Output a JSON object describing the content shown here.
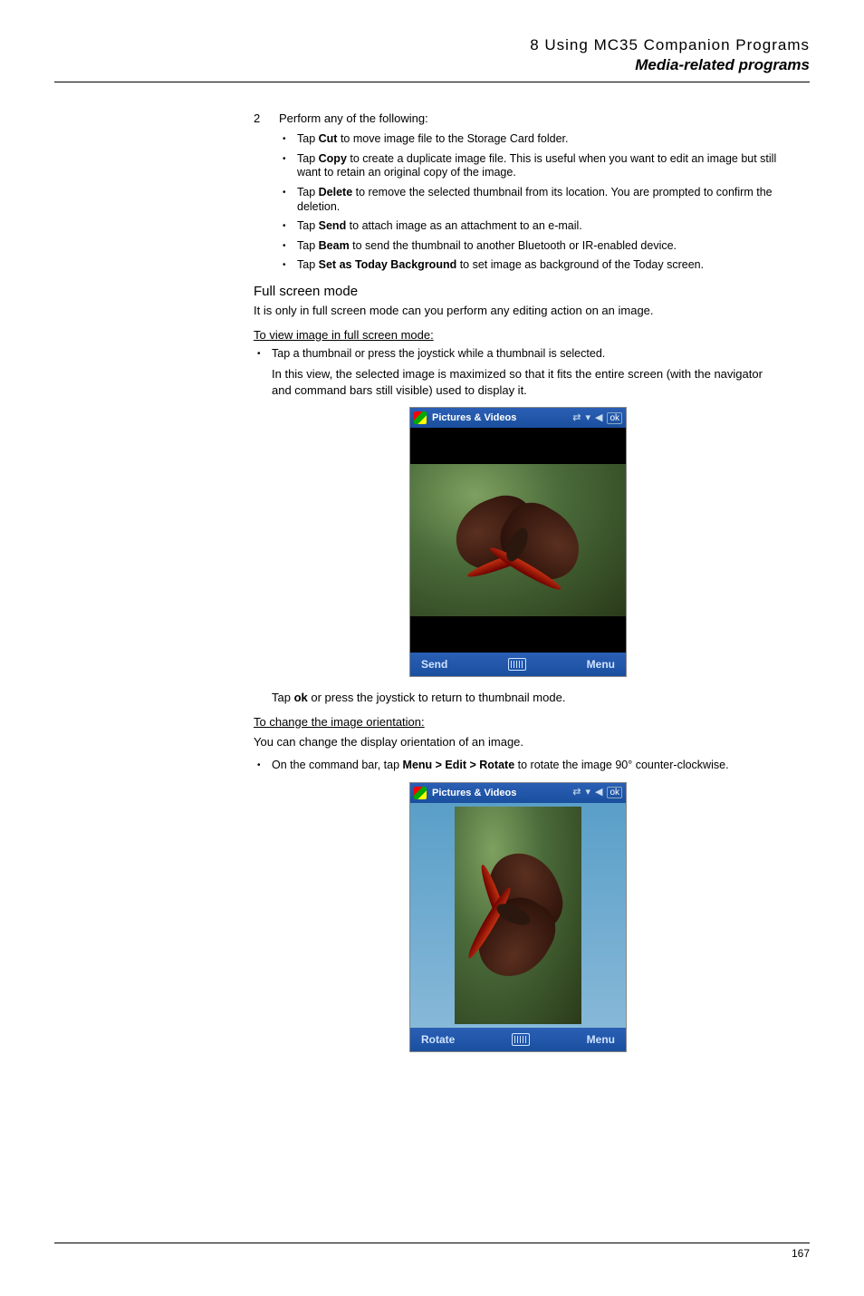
{
  "header": {
    "chapter": "8 Using MC35 Companion Programs",
    "section": "Media-related programs"
  },
  "step": {
    "num": "2",
    "intro": "Perform any of the following:"
  },
  "bullets": [
    {
      "action": "Cut",
      "before": "Tap ",
      "after": " to move image file to the Storage Card folder."
    },
    {
      "action": "Copy",
      "before": "Tap ",
      "after": " to create a duplicate image file. This is useful when you want to edit an image but still want to retain an original copy of the image."
    },
    {
      "action": "Delete",
      "before": "Tap ",
      "after": " to remove the selected thumbnail from its location. You are prompted to confirm the deletion."
    },
    {
      "action": "Send",
      "before": "Tap ",
      "after": " to attach image as an attachment to an e-mail."
    },
    {
      "action": "Beam",
      "before": "Tap ",
      "after": " to send the thumbnail to another Bluetooth or IR-enabled device."
    },
    {
      "action": "Set as Today Background",
      "before": "Tap ",
      "after": " to set image as background of the Today screen."
    }
  ],
  "fullscreen": {
    "heading": "Full screen mode",
    "intro": "It is only in full screen mode can you perform any editing action on an image."
  },
  "view_proc": {
    "heading": "To view image in full screen mode:",
    "bullet1": "Tap a thumbnail or press the joystick while a thumbnail is selected.",
    "bullet2": "In this view, the selected image is maximized so that it fits the entire screen (with the navigator and command bars still visible) used to display it.",
    "closing_before": "Tap ",
    "closing_bold": "ok",
    "closing_after": " or press the joystick to return to thumbnail mode."
  },
  "rotate_proc": {
    "heading": "To change the image orientation:",
    "intro": "You can change the display orientation of an image.",
    "bullet_before": "On the command bar, tap ",
    "bullet_bold": "Menu > Edit > Rotate",
    "bullet_after": " to rotate the image 90° counter-clockwise."
  },
  "shot1": {
    "title": "Pictures & Videos",
    "ok": "ok",
    "left": "Send",
    "right": "Menu"
  },
  "shot2": {
    "title": "Pictures & Videos",
    "ok": "ok",
    "left": "Rotate",
    "right": "Menu"
  },
  "page_number": "167"
}
